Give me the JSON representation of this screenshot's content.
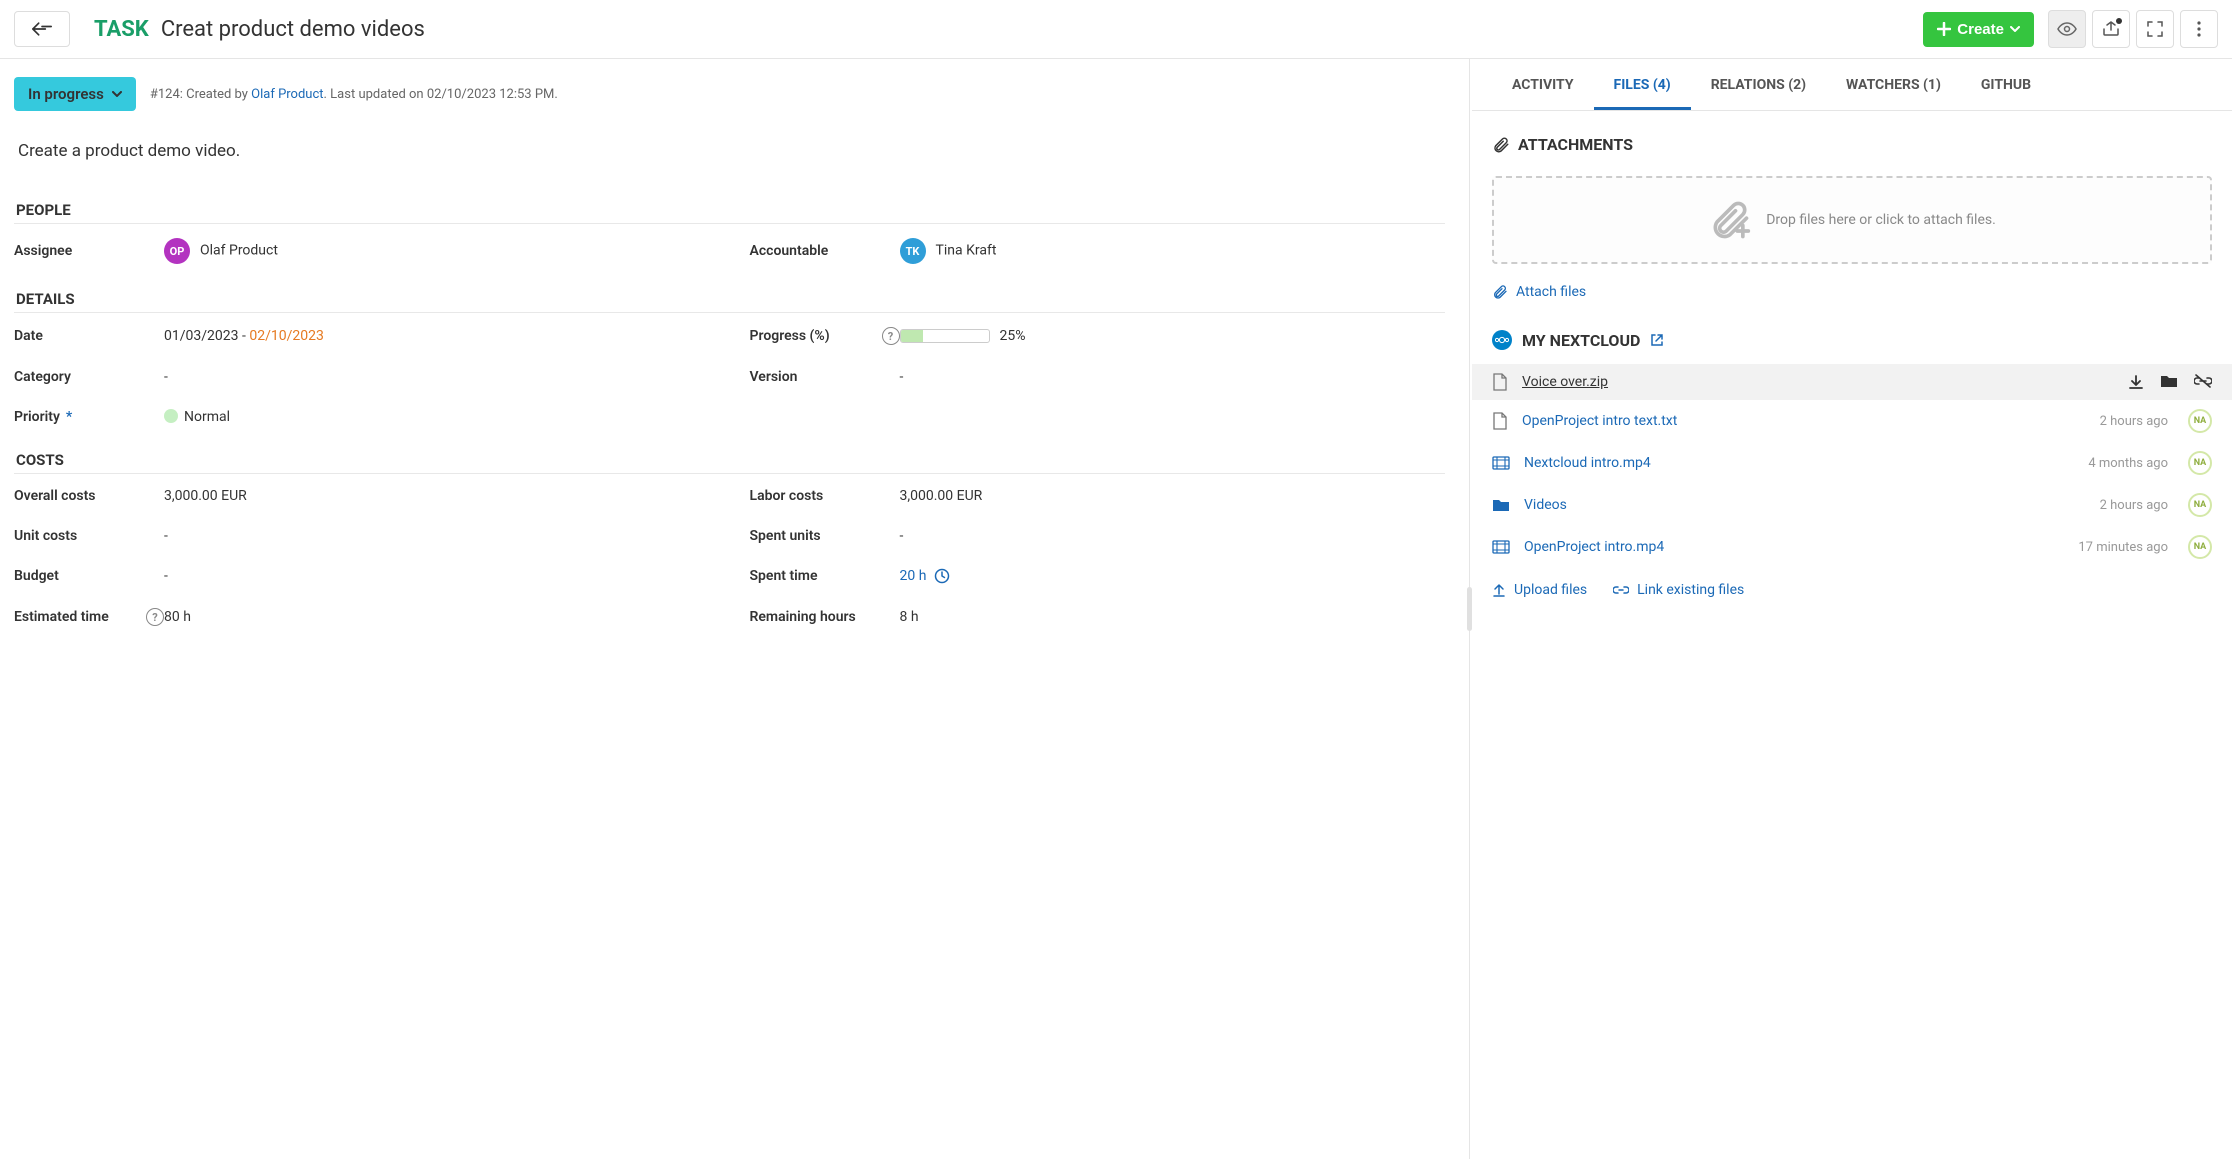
{
  "header": {
    "type": "TASK",
    "title": "Creat product demo videos",
    "create_button": "Create"
  },
  "status": {
    "label": "In progress",
    "meta_prefix": "#124: Created by ",
    "meta_author": "Olaf Product",
    "meta_suffix": ". Last updated on 02/10/2023 12:53 PM."
  },
  "description": "Create a product demo video.",
  "sections": {
    "people": "PEOPLE",
    "details": "DETAILS",
    "costs": "COSTS"
  },
  "people": {
    "assignee_label": "Assignee",
    "assignee_initials": "OP",
    "assignee_name": "Olaf Product",
    "accountable_label": "Accountable",
    "accountable_initials": "TK",
    "accountable_name": "Tina Kraft"
  },
  "details": {
    "date_label": "Date",
    "date_start": "01/03/2023",
    "date_sep": " - ",
    "date_end": "02/10/2023",
    "progress_label": "Progress (%)",
    "progress_pct": 25,
    "progress_text": "25%",
    "category_label": "Category",
    "category_value": "-",
    "version_label": "Version",
    "version_value": "-",
    "priority_label": "Priority",
    "priority_value": "Normal"
  },
  "costs": {
    "overall_label": "Overall costs",
    "overall_value": "3,000.00 EUR",
    "labor_label": "Labor costs",
    "labor_value": "3,000.00 EUR",
    "unit_label": "Unit costs",
    "unit_value": "-",
    "spentunits_label": "Spent units",
    "spentunits_value": "-",
    "budget_label": "Budget",
    "budget_value": "-",
    "spenttime_label": "Spent time",
    "spenttime_value": "20 h",
    "estimated_label": "Estimated time",
    "estimated_value": "80 h",
    "remaining_label": "Remaining hours",
    "remaining_value": "8 h"
  },
  "tabs": {
    "activity": "ACTIVITY",
    "files": "FILES (4)",
    "relations": "RELATIONS (2)",
    "watchers": "WATCHERS (1)",
    "github": "GITHUB"
  },
  "attachments": {
    "header": "ATTACHMENTS",
    "drop_text": "Drop files here or click to attach files.",
    "attach_link": "Attach files"
  },
  "nextcloud": {
    "header": "MY NEXTCLOUD",
    "files": [
      {
        "name": "Voice over.zip",
        "meta": "",
        "icon": "file",
        "hover": true
      },
      {
        "name": "OpenProject intro text.txt",
        "meta": "2 hours ago",
        "icon": "file",
        "badge": "NA"
      },
      {
        "name": "Nextcloud intro.mp4",
        "meta": "4 months ago",
        "icon": "video",
        "badge": "NA"
      },
      {
        "name": "Videos",
        "meta": "2 hours ago",
        "icon": "folder",
        "badge": "NA"
      },
      {
        "name": "OpenProject intro.mp4",
        "meta": "17 minutes ago",
        "icon": "video",
        "badge": "NA"
      }
    ],
    "upload": "Upload files",
    "link_existing": "Link existing files"
  }
}
